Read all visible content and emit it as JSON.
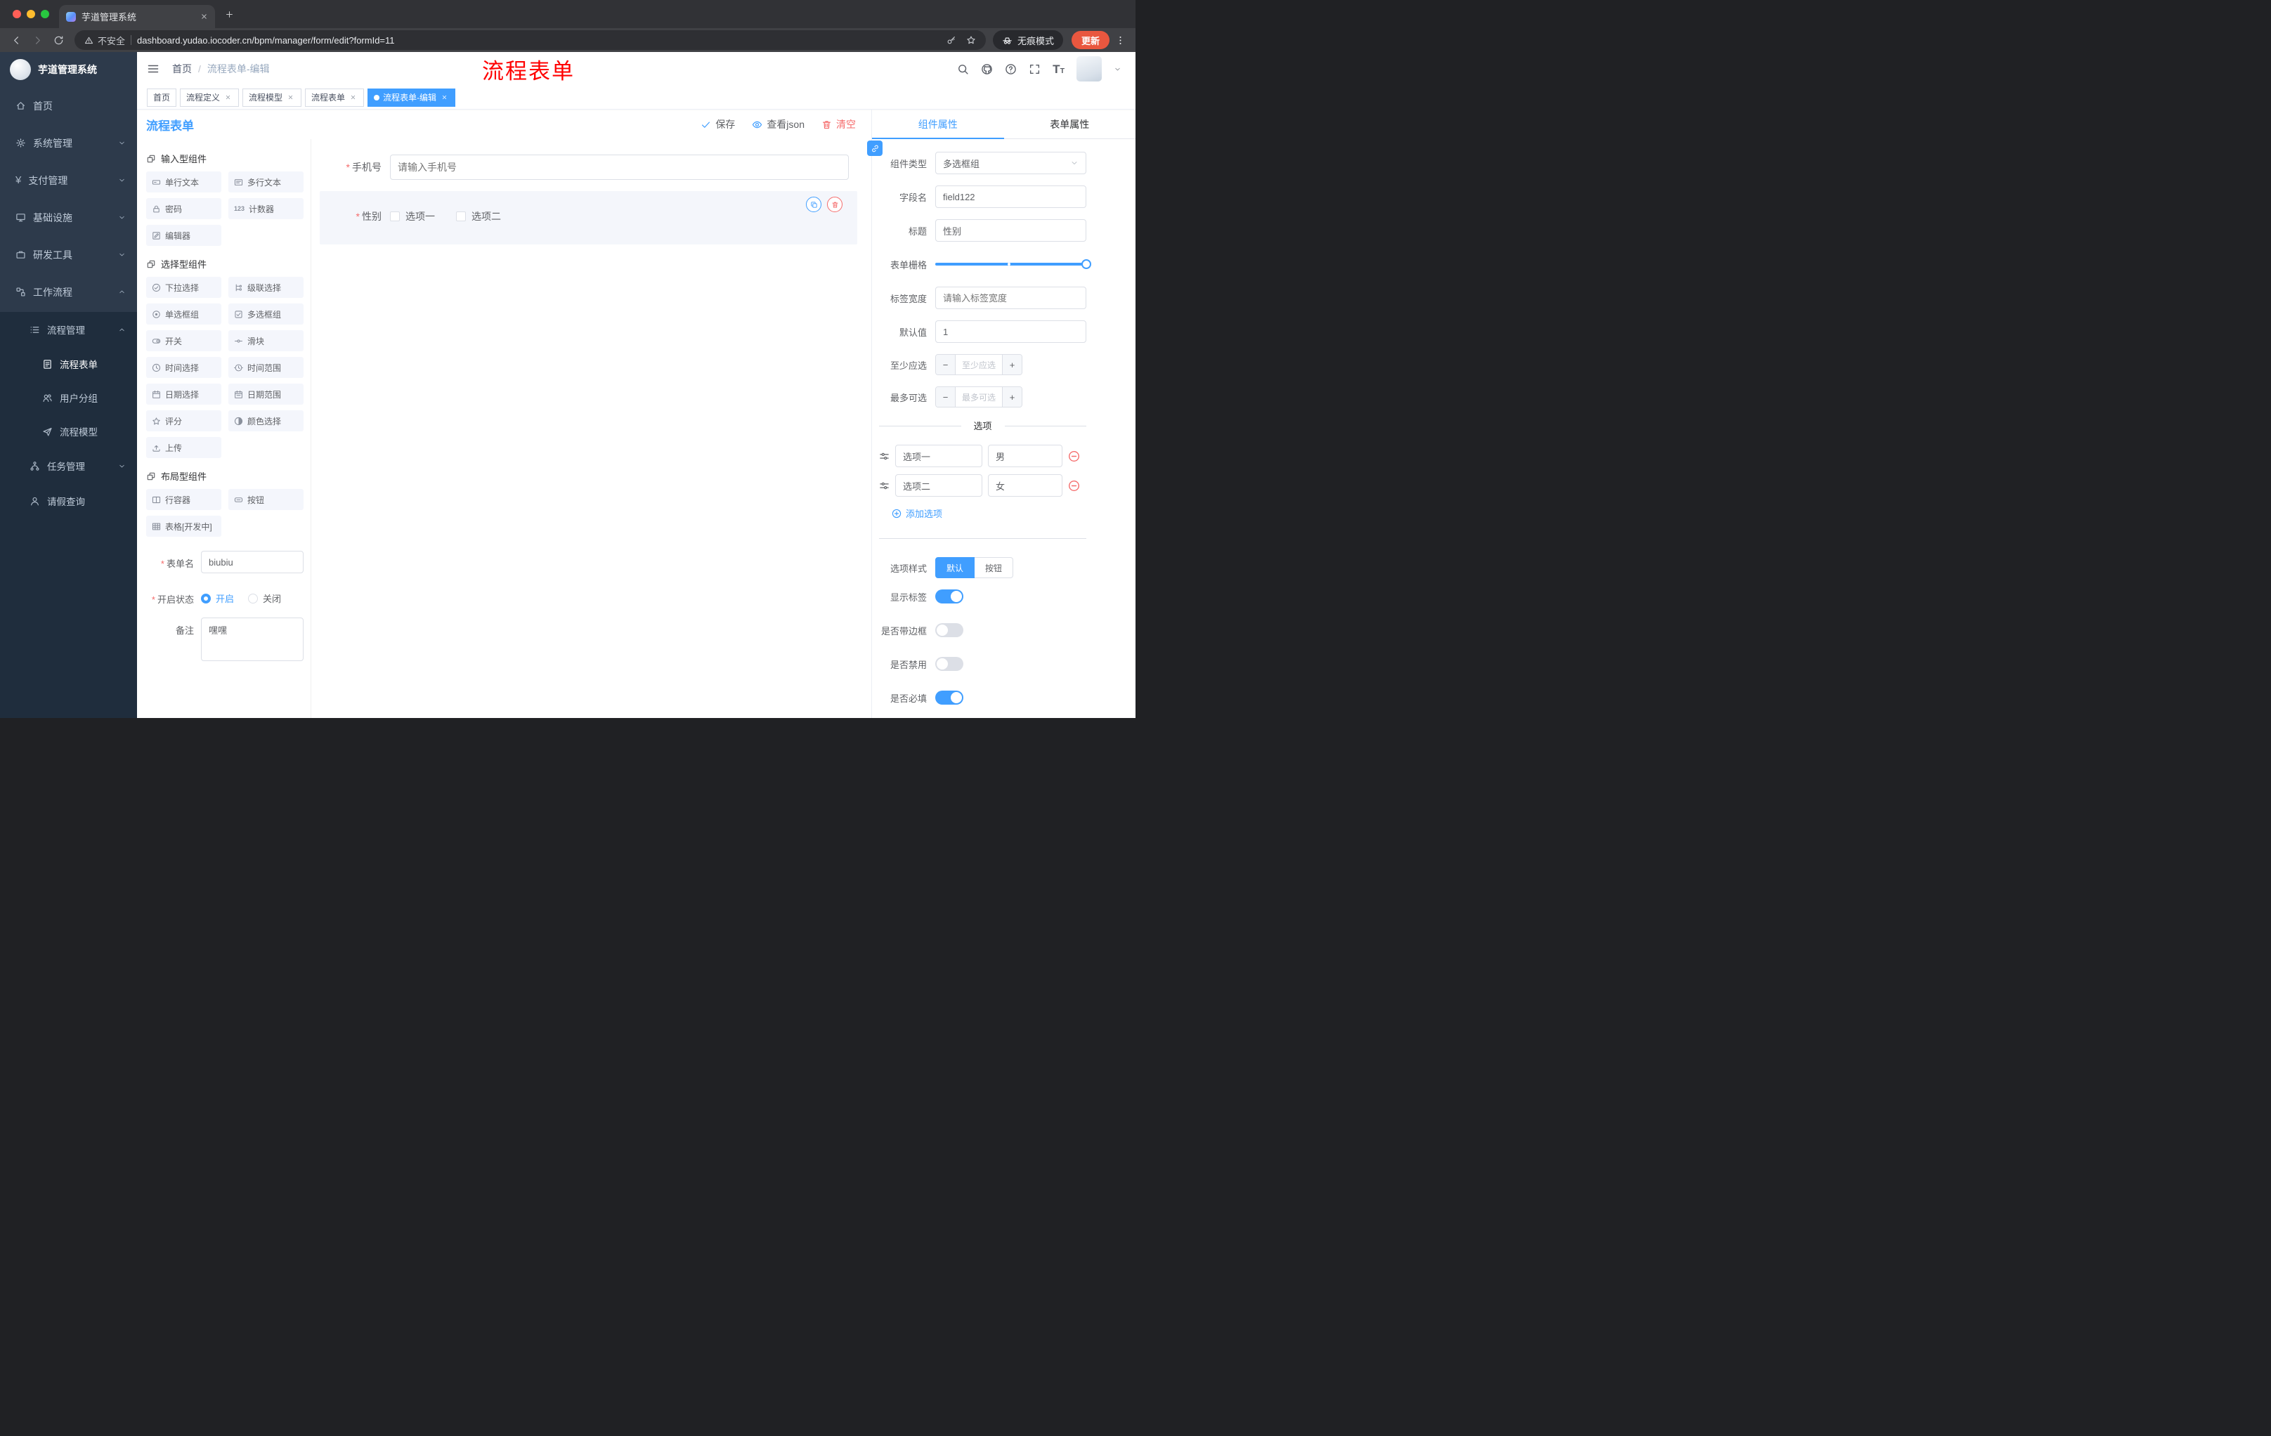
{
  "colors": {
    "accent": "#409eff",
    "danger": "#f56c6c",
    "annotation": "#ff0000",
    "update_button": "#e9573f",
    "sidebar_bg": "#2d3a4b",
    "submenu_bg": "#1f2d3d"
  },
  "browser": {
    "tab_title": "芋道管理系统",
    "security_label": "不安全",
    "url": "dashboard.yudao.iocoder.cn/bpm/manager/form/edit?formId=11",
    "incognito_label": "无痕模式",
    "update_label": "更新"
  },
  "sidebar": {
    "logo_title": "芋道管理系统",
    "menu": [
      {
        "label": "首页",
        "name": "home",
        "icon": "home-icon",
        "level": 1
      },
      {
        "label": "系统管理",
        "name": "system-management",
        "icon": "gear-icon",
        "level": 1,
        "arrow": "down"
      },
      {
        "label": "支付管理",
        "name": "payment-management",
        "icon": "currency-icon",
        "level": 1,
        "arrow": "down"
      },
      {
        "label": "基础设施",
        "name": "infrastructure",
        "icon": "monitor-icon",
        "level": 1,
        "arrow": "down"
      },
      {
        "label": "研发工具",
        "name": "dev-tools",
        "icon": "briefcase-icon",
        "level": 1,
        "arrow": "down"
      },
      {
        "label": "工作流程",
        "name": "workflow",
        "icon": "workflow-icon",
        "level": 1,
        "arrow": "up"
      },
      {
        "label": "流程管理",
        "name": "process-management",
        "icon": "list-icon",
        "level": 2,
        "arrow": "up",
        "dark": true
      },
      {
        "label": "流程表单",
        "name": "process-form",
        "icon": "form-icon",
        "level": 3,
        "active": true,
        "dark": true
      },
      {
        "label": "用户分组",
        "name": "user-group",
        "icon": "users-icon",
        "level": 3,
        "dark": true
      },
      {
        "label": "流程模型",
        "name": "process-model",
        "icon": "paper-plane-icon",
        "level": 3,
        "dark": true
      },
      {
        "label": "任务管理",
        "name": "task-management",
        "icon": "tasks-icon",
        "level": 2,
        "arrow": "down",
        "dark": true
      },
      {
        "label": "请假查询",
        "name": "leave-query",
        "icon": "person-icon",
        "level": 2,
        "dark": true
      }
    ]
  },
  "header": {
    "breadcrumb": [
      "首页",
      "流程表单-编辑"
    ],
    "annotation": "流程表单",
    "icons": [
      "search-icon",
      "github-icon",
      "question-icon",
      "fullscreen-icon",
      "font-size-icon"
    ]
  },
  "tags": [
    {
      "label": "首页",
      "name": "home"
    },
    {
      "label": "流程定义",
      "name": "process-definition",
      "closable": true
    },
    {
      "label": "流程模型",
      "name": "process-model",
      "closable": true
    },
    {
      "label": "流程表单",
      "name": "process-form",
      "closable": true
    },
    {
      "label": "流程表单-编辑",
      "name": "process-form-edit",
      "closable": true,
      "active": true
    }
  ],
  "designer": {
    "title": "流程表单",
    "toolbar": [
      {
        "label": "保存",
        "name": "save",
        "icon": "check-icon"
      },
      {
        "label": "查看json",
        "name": "view-json",
        "icon": "eye-icon"
      },
      {
        "label": "清空",
        "name": "clear",
        "icon": "trash-icon",
        "danger": true
      }
    ],
    "palette": [
      {
        "title": "输入型组件",
        "name": "input-components",
        "items": [
          {
            "label": "单行文本",
            "name": "single-line-text",
            "icon": "text-field-icon"
          },
          {
            "label": "多行文本",
            "name": "multi-line-text",
            "icon": "textarea-icon"
          },
          {
            "label": "密码",
            "name": "password",
            "icon": "password-icon"
          },
          {
            "label": "计数器",
            "name": "counter",
            "icon": "counter-icon"
          },
          {
            "label": "编辑器",
            "name": "editor",
            "icon": "editor-icon"
          }
        ]
      },
      {
        "title": "选择型组件",
        "name": "select-components",
        "items": [
          {
            "label": "下拉选择",
            "name": "select",
            "icon": "select-icon"
          },
          {
            "label": "级联选择",
            "name": "cascader",
            "icon": "cascader-icon"
          },
          {
            "label": "单选框组",
            "name": "radio-group",
            "icon": "radio-icon"
          },
          {
            "label": "多选框组",
            "name": "checkbox-group",
            "icon": "checkbox-icon"
          },
          {
            "label": "开关",
            "name": "switch",
            "icon": "switch-icon"
          },
          {
            "label": "滑块",
            "name": "slider",
            "icon": "slider-icon"
          },
          {
            "label": "时间选择",
            "name": "time-picker",
            "icon": "time-icon"
          },
          {
            "label": "时间范围",
            "name": "time-range",
            "icon": "time-range-icon"
          },
          {
            "label": "日期选择",
            "name": "date-picker",
            "icon": "date-icon"
          },
          {
            "label": "日期范围",
            "name": "date-range",
            "icon": "date-range-icon"
          },
          {
            "label": "评分",
            "name": "rate",
            "icon": "rate-icon"
          },
          {
            "label": "颜色选择",
            "name": "color-picker",
            "icon": "color-icon"
          },
          {
            "label": "上传",
            "name": "upload",
            "icon": "upload-icon"
          }
        ]
      },
      {
        "title": "布局型组件",
        "name": "layout-components",
        "items": [
          {
            "label": "行容器",
            "name": "row-container",
            "icon": "row-icon"
          },
          {
            "label": "按钮",
            "name": "button",
            "icon": "button-icon"
          },
          {
            "label": "表格[开发中]",
            "name": "table",
            "icon": "table-icon"
          }
        ]
      }
    ],
    "form_settings": {
      "name_label": "表单名",
      "name_value": "biubiu",
      "status_label": "开启状态",
      "status_options": [
        {
          "label": "开启",
          "name": "enabled",
          "checked": true
        },
        {
          "label": "关闭",
          "name": "disabled"
        }
      ],
      "remark_label": "备注",
      "remark_value": "嘿嘿"
    },
    "canvas": {
      "phone": {
        "label": "手机号",
        "placeholder": "请输入手机号"
      },
      "gender": {
        "label": "性别",
        "options": [
          "选项一",
          "选项二"
        ]
      }
    }
  },
  "properties": {
    "tabs": [
      {
        "label": "组件属性",
        "name": "component-props",
        "active": true
      },
      {
        "label": "表单属性",
        "name": "form-props"
      }
    ],
    "component_type": {
      "label": "组件类型",
      "value": "多选框组"
    },
    "field_name": {
      "label": "字段名",
      "value": "field122"
    },
    "title": {
      "label": "标题",
      "value": "性别"
    },
    "grid": {
      "label": "表单栅格"
    },
    "label_width": {
      "label": "标签宽度",
      "placeholder": "请输入标签宽度"
    },
    "default_value": {
      "label": "默认值",
      "value": "1"
    },
    "min_select": {
      "label": "至少应选",
      "placeholder": "至少应选"
    },
    "max_select": {
      "label": "最多可选",
      "placeholder": "最多可选"
    },
    "options_divider": "选项",
    "options": [
      {
        "label": "选项一",
        "value": "男"
      },
      {
        "label": "选项二",
        "value": "女"
      }
    ],
    "add_option_label": "添加选项",
    "option_style": {
      "label": "选项样式",
      "choices": [
        {
          "label": "默认",
          "name": "default",
          "active": true
        },
        {
          "label": "按钮",
          "name": "button"
        }
      ]
    },
    "switches": [
      {
        "label": "显示标签",
        "name": "show-label",
        "on": true
      },
      {
        "label": "是否带边框",
        "name": "with-border",
        "on": false
      },
      {
        "label": "是否禁用",
        "name": "disabled",
        "on": false
      },
      {
        "label": "是否必填",
        "name": "required",
        "on": true
      }
    ]
  }
}
